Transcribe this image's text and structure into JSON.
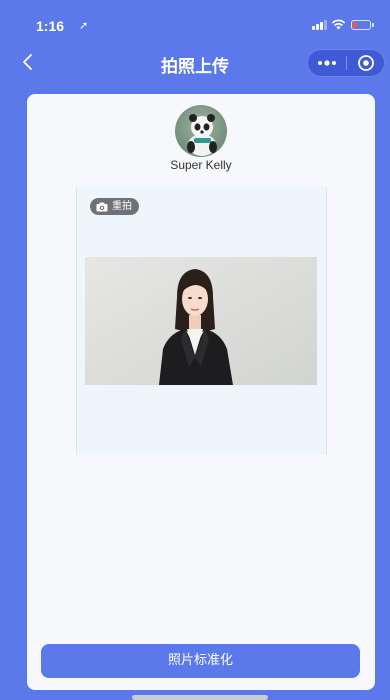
{
  "status_bar": {
    "time": "1:16",
    "location_glyph": "➚",
    "battery_color": "#ff4d4d"
  },
  "nav": {
    "title": "拍照上传",
    "back_icon": "chevron-left-icon",
    "more_icon": "more-dots-icon",
    "close_icon": "target-circle-icon"
  },
  "profile": {
    "name": "Super Kelly",
    "avatar_icon": "panda-avatar"
  },
  "photo_panel": {
    "retake_label": "重拍",
    "retake_icon": "camera-icon"
  },
  "actions": {
    "standardize_label": "照片标准化"
  },
  "colors": {
    "primary": "#5b79ea",
    "card_bg": "#f7f8fb",
    "panel_bg": "#eef5fb"
  }
}
